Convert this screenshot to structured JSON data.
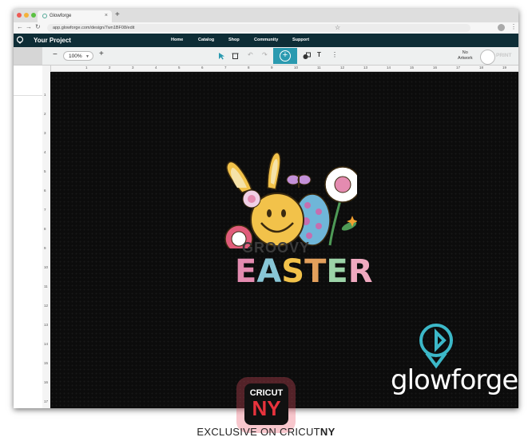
{
  "browser": {
    "tab_title": "Glowforge",
    "new_tab": "+",
    "url": "app.glowforge.com/design/7wn1BF08/edit",
    "back": "←",
    "forward": "→",
    "reload": "↻"
  },
  "app": {
    "project_title": "Your Project",
    "nav": [
      "Home",
      "Catalog",
      "Shop",
      "Community",
      "Support"
    ]
  },
  "toolbar": {
    "zoom_out": "−",
    "zoom": "100%",
    "zoom_in": "+",
    "no_artwork_line1": "No",
    "no_artwork_line2": "Artwork",
    "print": "PRINT",
    "text_tool": "T",
    "more": "⋮"
  },
  "ruler": {
    "top": [
      "1",
      "2",
      "3",
      "4",
      "5",
      "6",
      "7",
      "8",
      "9",
      "10",
      "11",
      "12",
      "13",
      "14",
      "15",
      "16",
      "17",
      "18",
      "19",
      "20"
    ],
    "left": [
      "1",
      "2",
      "3",
      "4",
      "5",
      "6",
      "7",
      "8",
      "9",
      "10",
      "11",
      "12",
      "13",
      "14",
      "15",
      "16",
      "17"
    ]
  },
  "design": {
    "groovy": "GROOVY",
    "easter_letters": [
      "E",
      "A",
      "S",
      "T",
      "E",
      "R"
    ],
    "easter_colors": [
      "#e48bb0",
      "#88c6d6",
      "#f2c24a",
      "#e3a05c",
      "#9cd3a8",
      "#f0a9c0"
    ]
  },
  "watermark": {
    "brand": "glowforge",
    "badge_top": "CRICUT",
    "badge_bottom": "NY",
    "exclusive_prefix": "EXCLUSIVE ON CRICUT",
    "exclusive_suffix": "NY"
  }
}
